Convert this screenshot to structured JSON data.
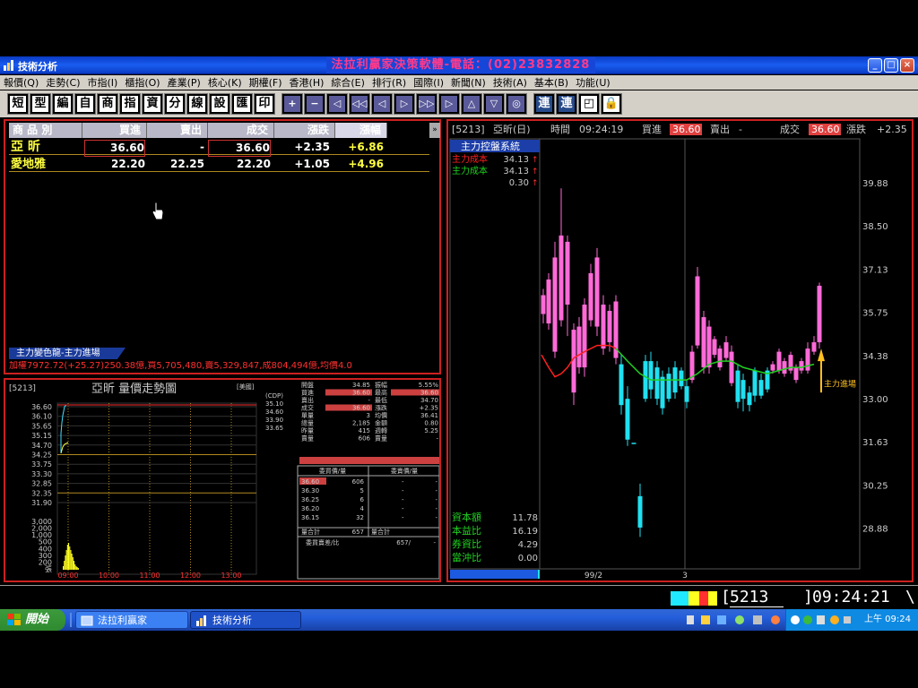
{
  "window": {
    "title": "技術分析",
    "caption": "法拉利贏家決策軟體-電話：(02)23832828",
    "min": "_",
    "max": "□",
    "close": "×"
  },
  "menu": [
    "報價(Q)",
    "走勢(C)",
    "市指(I)",
    "櫃指(O)",
    "產業(P)",
    "核心(K)",
    "期權(F)",
    "香港(H)",
    "綜合(E)",
    "排行(R)",
    "國際(I)",
    "新聞(N)",
    "技術(A)",
    "基本(B)",
    "功能(U)"
  ],
  "toolbar": [
    "短",
    "型",
    "編",
    "自",
    "商",
    "指",
    "資",
    "分",
    "線",
    "設",
    "匯",
    "印",
    "+",
    "−",
    "◁",
    "◁◁",
    "◁",
    "▷",
    "▷▷",
    "▷",
    "△",
    "▽",
    "◎",
    "連",
    "連",
    "◰",
    "🔒"
  ],
  "quotes": {
    "headers": [
      "商 品 別",
      "買進",
      "賣出",
      "成交",
      "漲跌",
      "漲幅"
    ],
    "rows": [
      {
        "name": "亞 昕",
        "bid": "36.60",
        "ask": "-",
        "last": "36.60",
        "chg": "+2.35",
        "pct": "+6.86"
      },
      {
        "name": "愛地雅",
        "bid": "22.20",
        "ask": "22.25",
        "last": "22.20",
        "chg": "+1.05",
        "pct": "+4.96"
      }
    ]
  },
  "mini_tab": "主力變色龍-主力進場",
  "ticker": "加權7972.72(+25.27)250.38億,買5,705,480,賣5,329,847,成804,494億,均價4.0",
  "intraday": {
    "code": "[5213]",
    "title": "亞昕 量價走勢圖",
    "tag": "[美國]",
    "yticks": [
      "36.60",
      "36.10",
      "35.65",
      "35.15",
      "34.70",
      "34.25",
      "33.75",
      "33.30",
      "32.85",
      "32.35",
      "31.90"
    ],
    "vticks": [
      "3,000",
      "2,000",
      "1,000",
      "500",
      "400",
      "300",
      "200",
      "張"
    ],
    "xticks": [
      "09:00",
      "10:00",
      "11:00",
      "12:00",
      "13:00"
    ],
    "side_labels": [
      "(CDP)",
      "35.10",
      "34.60",
      "33.90",
      "33.65"
    ],
    "info": [
      [
        "開盤",
        "34.85",
        "振幅",
        "5.55%"
      ],
      [
        "買進",
        "36.60",
        "最高",
        "36.60"
      ],
      [
        "賣出",
        "-",
        "最低",
        "34.70"
      ],
      [
        "成交",
        "36.60",
        "漲跌",
        "+2.35"
      ],
      [
        "單量",
        "3",
        "均價",
        "36.41"
      ],
      [
        "總量",
        "2,185",
        "金額",
        "0.80"
      ],
      [
        "昨量",
        "415",
        "週轉",
        "5.25"
      ],
      [
        "賣量",
        "606",
        "賣量",
        "-"
      ]
    ],
    "book_headers": [
      "委買價/量",
      "委賣價/量"
    ],
    "book": [
      [
        "36.60",
        "606",
        "-",
        "-"
      ],
      [
        "36.30",
        "5",
        "-",
        "-"
      ],
      [
        "36.25",
        "6",
        "-",
        "-"
      ],
      [
        "36.20",
        "4",
        "-",
        "-"
      ],
      [
        "36.15",
        "32",
        "-",
        "-"
      ]
    ],
    "book_total": [
      "量合計",
      "657",
      "量合計",
      ""
    ],
    "book_ratio": [
      "委買賣差/比",
      "657/",
      "-"
    ]
  },
  "rt": {
    "code": "[5213]",
    "name": "亞昕(日)",
    "time_label": "時間",
    "time": "09:24:19",
    "bid_label": "買進",
    "bid": "36.60",
    "ask_label": "賣出",
    "ask": "-",
    "last_label": "成交",
    "last": "36.60",
    "chg_label": "漲跌",
    "chg": "+2.35",
    "system_title": "主力控盤系統",
    "legend": [
      {
        "label": "主力成本",
        "value": "34.13",
        "color": "#ff2020"
      },
      {
        "label": "主力成本",
        "value": "34.13",
        "color": "#20d020"
      },
      {
        "label": "",
        "value": "0.30",
        "color": "#ffffff"
      }
    ],
    "yticks": [
      "39.88",
      "38.50",
      "37.13",
      "35.75",
      "34.38",
      "33.00",
      "31.63",
      "30.25",
      "28.88"
    ],
    "annotation": "主力進場",
    "stats": [
      {
        "label": "資本額",
        "value": "11.78"
      },
      {
        "label": "本益比",
        "value": "16.19"
      },
      {
        "label": "券資比",
        "value": "4.29"
      },
      {
        "label": "當沖比",
        "value": "0.00"
      }
    ],
    "xlabels": [
      "99/2",
      "3"
    ]
  },
  "status": {
    "code": "5213",
    "clock": "09:24:21",
    "tail": "\\"
  },
  "taskbar": {
    "start": "開始",
    "tasks": [
      "法拉利贏家",
      "技術分析"
    ],
    "clock": "上午 09:24"
  }
}
